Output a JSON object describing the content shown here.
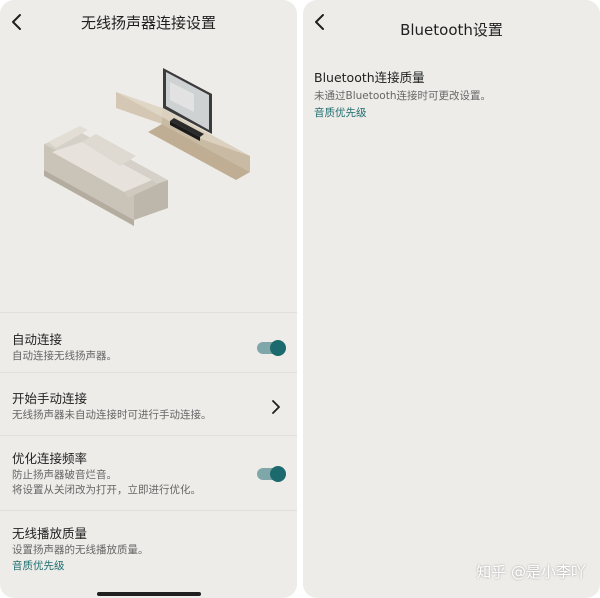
{
  "left_screen": {
    "title": "无线扬声器连接设置",
    "settings": [
      {
        "title": "自动连接",
        "subtitle": "自动连接无线扬声器。",
        "control": "toggle",
        "toggle_on": true
      },
      {
        "title": "开始手动连接",
        "subtitle": "无线扬声器未自动连接时可进行手动连接。",
        "control": "chevron"
      },
      {
        "title": "优化连接频率",
        "subtitle_line1": "防止扬声器破音烂音。",
        "subtitle_line2": "将设置从关闭改为打开，立即进行优化。",
        "control": "toggle",
        "toggle_on": true
      },
      {
        "title": "无线播放质量",
        "subtitle": "设置扬声器的无线播放质量。",
        "link": "音质优先级"
      }
    ]
  },
  "right_screen": {
    "title": "Bluetooth设置",
    "setting": {
      "title": "Bluetooth连接质量",
      "subtitle": "未通过Bluetooth连接时可更改设置。",
      "link": "音质优先级"
    }
  },
  "watermark": "知乎 @是小李吖",
  "colors": {
    "panel_bg": "#eeece9",
    "accent": "#1d6a6e",
    "link": "#1f6f70",
    "toggle_track": "#7fa7aa"
  },
  "icons": [
    "back-arrow-icon",
    "chevron-right-icon",
    "toggle-switch"
  ]
}
